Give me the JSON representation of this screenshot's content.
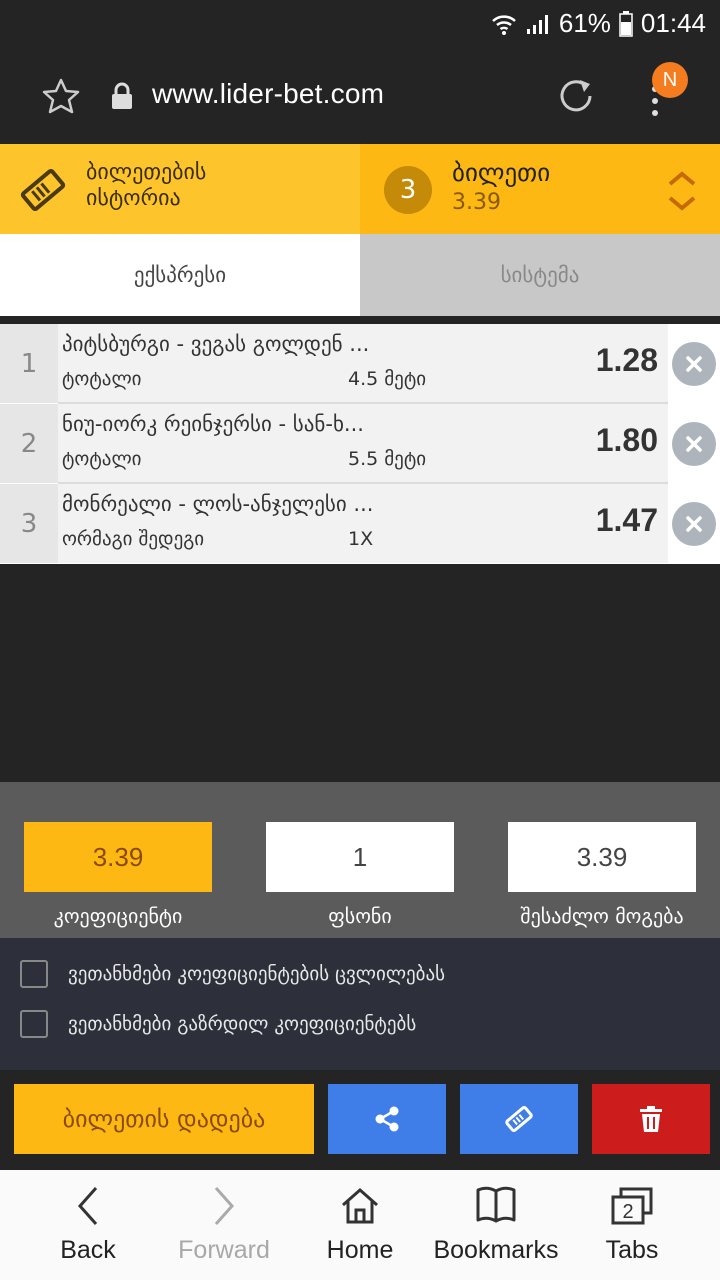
{
  "status_bar": {
    "battery": "61%",
    "time": "01:44"
  },
  "browser": {
    "url": "www.lider-bet.com",
    "notification_badge": "N"
  },
  "ticket_header": {
    "history_label_line1": "ბილეთების",
    "history_label_line2": "ისტორია",
    "ticket_count": "3",
    "ticket_title": "ბილეთი",
    "ticket_odds": "3.39"
  },
  "tabs": {
    "express": "ექსპრესი",
    "system": "სისტემა"
  },
  "bets": [
    {
      "index": "1",
      "match": "პიტსბურგი - ვეგას გოლდენ ...",
      "market": "ტოტალი",
      "pick": "4.5 მეტი",
      "odds": "1.28"
    },
    {
      "index": "2",
      "match": "ნიუ-იორკ რეინჯერსი - სან-ხ...",
      "market": "ტოტალი",
      "pick": "5.5 მეტი",
      "odds": "1.80"
    },
    {
      "index": "3",
      "match": "მონრეალი - ლოს-ანჯელესი ...",
      "market": "ორმაგი შედეგი",
      "pick": "1X",
      "odds": "1.47"
    }
  ],
  "totals": {
    "coefficient_value": "3.39",
    "stake_value": "1",
    "possible_win_value": "3.39",
    "coefficient_label": "კოეფიციენტი",
    "stake_label": "ფსონი",
    "possible_win_label": "შესაძლო მოგება"
  },
  "agreements": {
    "accept_odds_change": "ვეთანხმები კოეფიციენტების ცვლილებას",
    "accept_increased_odds": "ვეთანხმები გაზრდილ კოეფიციენტებს"
  },
  "actions": {
    "place_bet": "ბილეთის დადება"
  },
  "bottom_nav": {
    "back": "Back",
    "forward": "Forward",
    "home": "Home",
    "bookmarks": "Bookmarks",
    "tabs": "Tabs",
    "tabs_count": "2"
  },
  "colors": {
    "accent_yellow": "#fdb813",
    "light_yellow": "#fec42c",
    "action_blue": "#3f7de8",
    "delete_red": "#cc1c1c",
    "notification_orange": "#f57c1f"
  }
}
